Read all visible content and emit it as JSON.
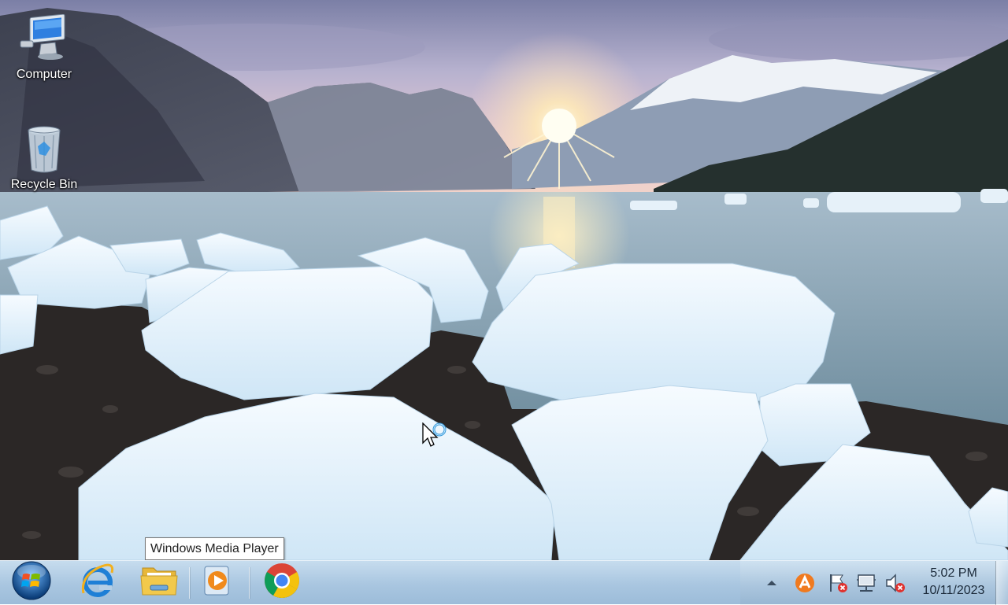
{
  "desktop": {
    "icons": [
      {
        "label": "Computer",
        "icon": "computer-icon"
      },
      {
        "label": "Recycle Bin",
        "icon": "recycle-bin-icon"
      }
    ]
  },
  "tooltip": {
    "text": "Windows Media Player"
  },
  "taskbar": {
    "start": {
      "icon": "windows-start-icon"
    },
    "pinned": [
      {
        "name": "Internet Explorer",
        "icon": "internet-explorer-icon"
      },
      {
        "name": "File Explorer",
        "icon": "folder-icon"
      },
      {
        "name": "Windows Media Player",
        "icon": "media-player-icon"
      },
      {
        "name": "Google Chrome",
        "icon": "chrome-icon"
      }
    ],
    "tray": {
      "icons": [
        "show-hidden-icons-arrow",
        "avast-icon",
        "action-center-flag-icon",
        "network-icon",
        "volume-muted-icon"
      ],
      "time": "5:02 PM",
      "date": "10/11/2023"
    }
  },
  "colors": {
    "taskbar": "#b4cfe6",
    "ie_blue": "#1e7fd6",
    "folder_yellow": "#f2c94c",
    "wmp_orange": "#f08a1c",
    "chrome_red": "#db4437",
    "chrome_yellow": "#f4c20d",
    "chrome_green": "#0f9d58",
    "chrome_blue": "#4285f4",
    "alert_red": "#e0322f"
  }
}
